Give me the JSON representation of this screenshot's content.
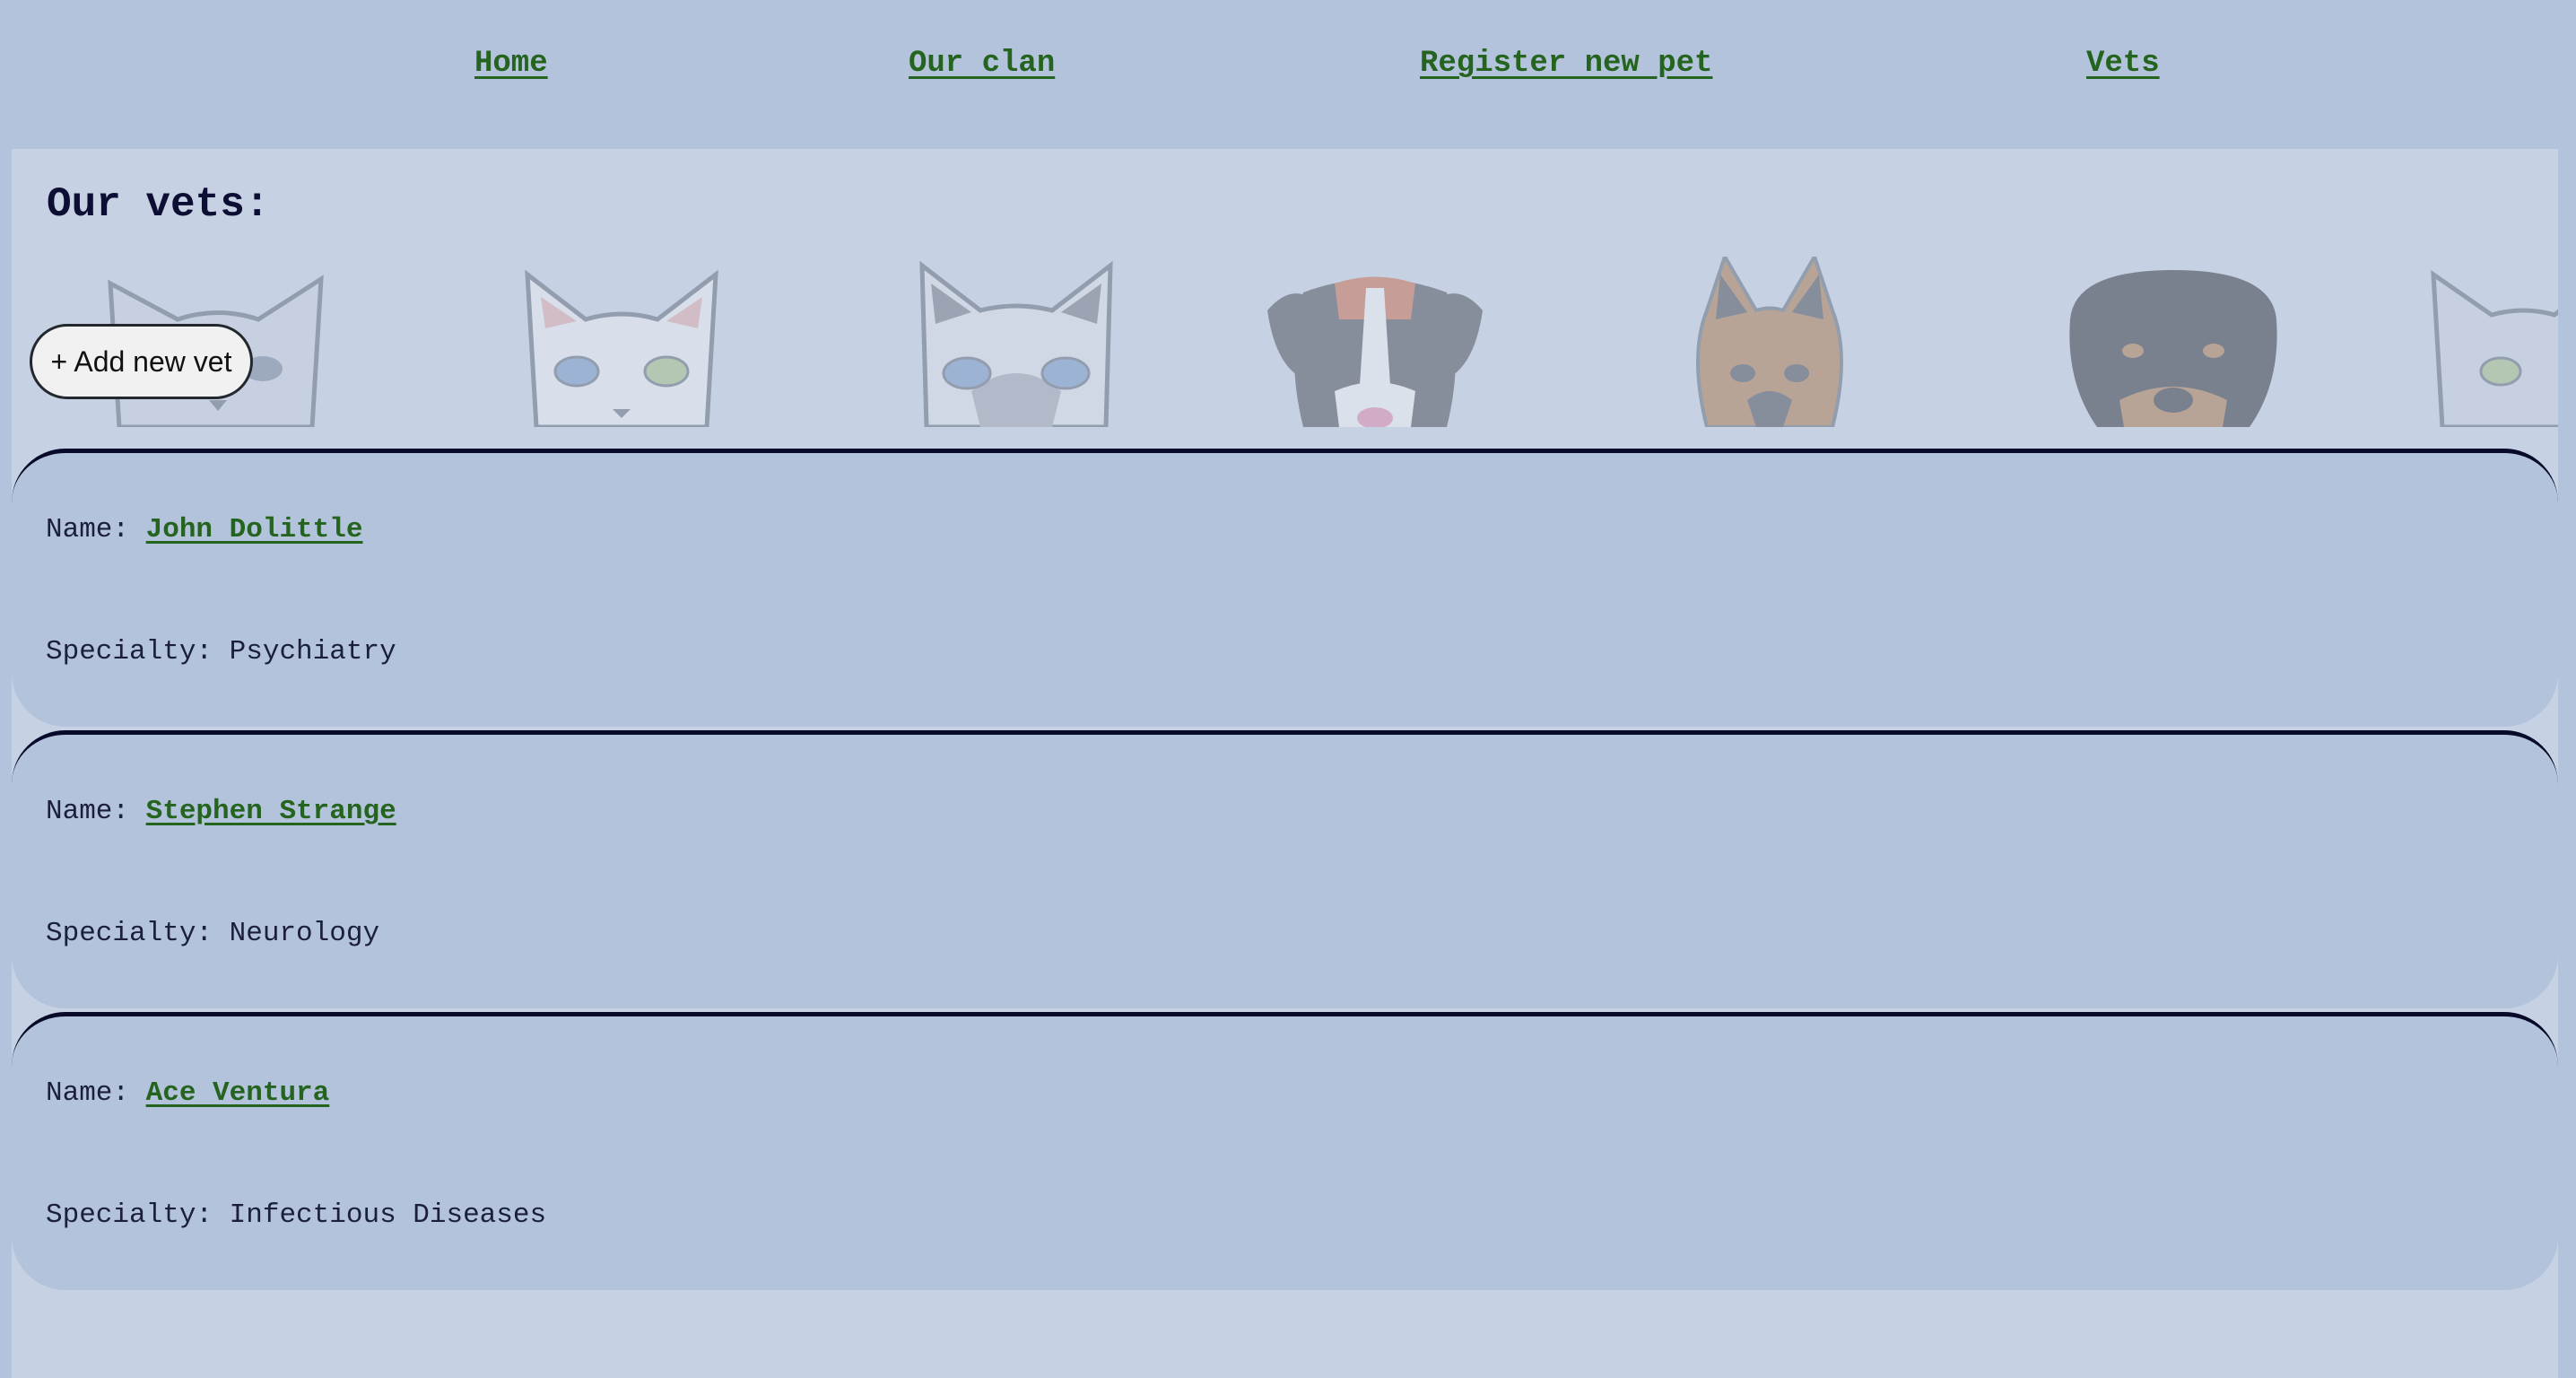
{
  "nav": {
    "home": "Home",
    "clan": "Our clan",
    "register": "Register new pet",
    "vets": "Vets"
  },
  "page": {
    "title": "Our vets:",
    "add_button": "+ Add new vet"
  },
  "labels": {
    "name": "Name: ",
    "specialty": "Specialty: "
  },
  "vets": [
    {
      "name": "John Dolittle",
      "specialty": "Psychiatry"
    },
    {
      "name": "Stephen Strange",
      "specialty": "Neurology"
    },
    {
      "name": "Ace Ventura",
      "specialty": "Infectious Diseases"
    }
  ],
  "colors": {
    "background": "#b3c3dc",
    "panel": "#c6d1e3",
    "link": "#24641e",
    "title": "#0c0f33",
    "card_border": "#080a2a"
  }
}
